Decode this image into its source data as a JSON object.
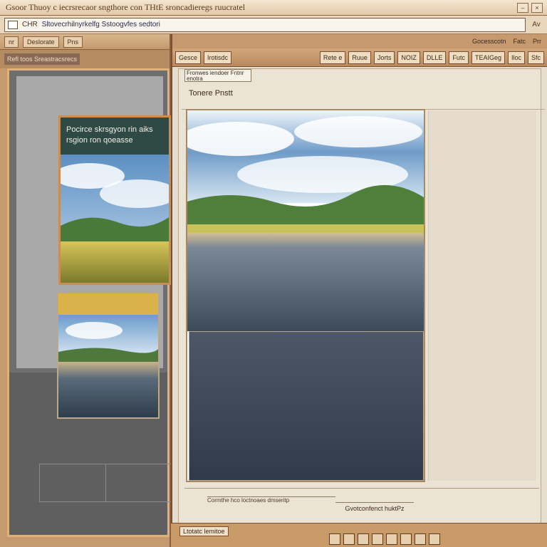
{
  "window": {
    "title": "Gsoor Thuoy c iecrsrecaor sngthore con THtE sroncadieregs ruucratel",
    "controls": [
      "–",
      "×"
    ]
  },
  "address_bar": {
    "tag": "CHR",
    "url": "Sltovecrhilnyrkelfg Sstoogvfes sedtori",
    "end_label": "Av"
  },
  "left_panel": {
    "toolbar": [
      "nr",
      "Deslorate",
      "Pns"
    ],
    "tab_label": "Refl toos Sreastracsrecs",
    "card_caption": "Pocirce skrsgyon rin aiks rsgion ron qoeasse"
  },
  "right_window": {
    "top_links": [
      "Gocesscotn",
      "Fatc",
      "Prr"
    ],
    "tabs": [
      "Gesce",
      "Irotisdc",
      "Rete e",
      "Ruue",
      "Jorts",
      "NOIZ",
      "DLLE",
      "Futc",
      "TEAIGeg",
      "Iloc",
      "Sfc"
    ],
    "doc_header": "Fronwes iendoer Fntnr enotra",
    "doc_title": "Tonere Pnstt",
    "footer_note": "Cormthe hco loctnoaes dmseritp",
    "footer_caption": "Gvotconfenct huktPz"
  },
  "status_bar": {
    "text": "Ltotatc lemitoe"
  },
  "colors": {
    "frame_brown": "#c49a6e",
    "accent_orange": "#e0b07a",
    "card_header": "#2f4a44",
    "sky_blue": "#6f9cc8"
  }
}
